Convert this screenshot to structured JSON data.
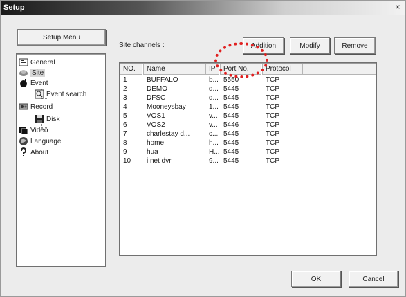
{
  "window": {
    "title": "Setup",
    "close_glyph": "×"
  },
  "sidebar": {
    "menu_button": "Setup Menu",
    "items": [
      {
        "label": "General",
        "icon": "general-icon"
      },
      {
        "label": "Site",
        "icon": "site-icon",
        "selected": true
      },
      {
        "label": "Event",
        "icon": "event-icon"
      },
      {
        "label": "Event search",
        "icon": "event-search-icon"
      },
      {
        "label": "Record",
        "icon": "record-icon"
      },
      {
        "label": "Disk",
        "icon": "disk-icon"
      },
      {
        "label": "Video",
        "icon": "video-icon"
      },
      {
        "label": "Language",
        "icon": "language-icon"
      },
      {
        "label": "About",
        "icon": "about-icon"
      }
    ]
  },
  "main": {
    "site_channels_label": "Site channels :",
    "buttons": {
      "addition": "Addition",
      "modify": "Modify",
      "remove": "Remove"
    },
    "table": {
      "headers": [
        "NO.",
        "Name",
        "IP",
        "Port No.",
        "Protocol"
      ],
      "rows": [
        [
          "1",
          "BUFFALO",
          "b...",
          "5550",
          "TCP"
        ],
        [
          "2",
          "DEMO",
          "d...",
          "5445",
          "TCP"
        ],
        [
          "3",
          "DFSC",
          "d...",
          "5445",
          "TCP"
        ],
        [
          "4",
          "Mooneysbay",
          "1...",
          "5445",
          "TCP"
        ],
        [
          "5",
          "VOS1",
          "v...",
          "5445",
          "TCP"
        ],
        [
          "6",
          "VOS2",
          "v...",
          "5446",
          "TCP"
        ],
        [
          "7",
          "charlestay d...",
          "c...",
          "5445",
          "TCP"
        ],
        [
          "8",
          "home",
          "h...",
          "5445",
          "TCP"
        ],
        [
          "9",
          "hua",
          "H...",
          "5445",
          "TCP"
        ],
        [
          "10",
          "i net dvr",
          "9...",
          "5445",
          "TCP"
        ]
      ]
    }
  },
  "footer": {
    "ok": "OK",
    "cancel": "Cancel"
  },
  "colors": {
    "annotation": "#e02020",
    "titlebar_dark": "#1a1a1a"
  }
}
